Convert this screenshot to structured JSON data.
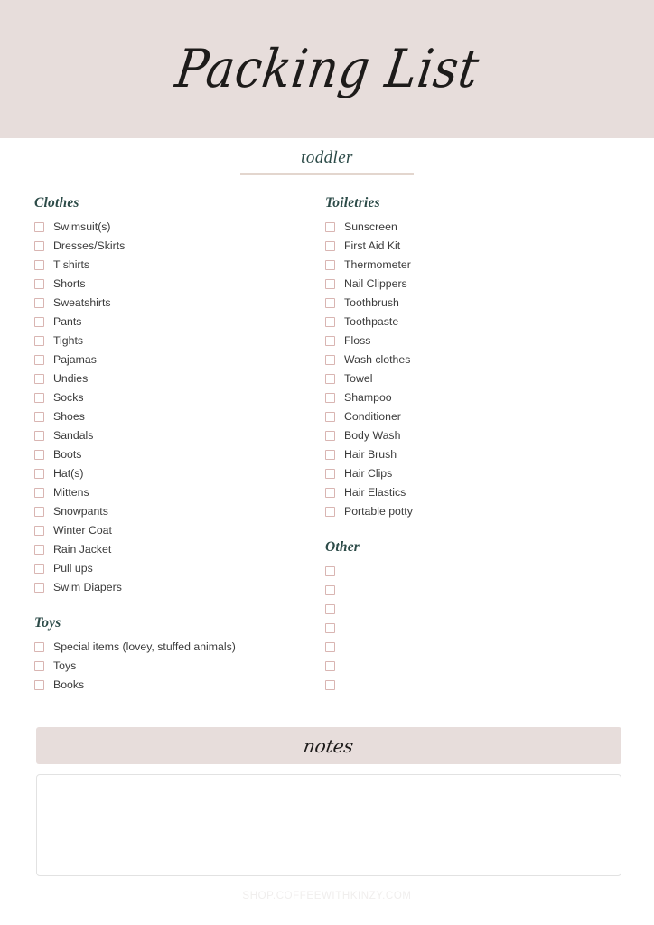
{
  "page": {
    "title_script": "Packing List",
    "subtitle": "toddler",
    "footer": "SHOP.COFFEEWITHKINZY.COM",
    "colors": {
      "band_background": "#e7dddb",
      "heading_text": "#2c4b48",
      "checkbox_border": "#d9b5b2",
      "item_text": "#3b3b3b",
      "rule": "#e3d6ce",
      "notes_border": "#e2e2e2",
      "footer_text": "#f0eeed",
      "page_background": "#ffffff"
    }
  },
  "notes": {
    "label": "notes",
    "value": "",
    "placeholder": ""
  },
  "columns": {
    "left": [
      {
        "heading": "Clothes",
        "items": [
          "Swimsuit(s)",
          "Dresses/Skirts",
          "T shirts",
          "Shorts",
          "Sweatshirts",
          "Pants",
          "Tights",
          "Pajamas",
          "Undies",
          "Socks",
          "Shoes",
          "Sandals",
          "Boots",
          "Hat(s)",
          "Mittens",
          "Snowpants",
          "Winter Coat",
          "Rain Jacket",
          "Pull ups",
          "Swim Diapers"
        ]
      },
      {
        "heading": "Toys",
        "items": [
          "Special items (lovey, stuffed animals)",
          "Toys",
          "Books"
        ]
      }
    ],
    "right": [
      {
        "heading": "Toiletries",
        "items": [
          "Sunscreen",
          "First Aid Kit",
          "Thermometer",
          "Nail Clippers",
          "Toothbrush",
          "Toothpaste",
          "Floss",
          "Wash clothes",
          "Towel",
          "Shampoo",
          "Conditioner",
          "Body Wash",
          "Hair Brush",
          "Hair Clips",
          "Hair Elastics",
          "Portable potty"
        ]
      },
      {
        "heading": "Other",
        "items": [
          "",
          "",
          "",
          "",
          "",
          "",
          ""
        ]
      }
    ]
  }
}
